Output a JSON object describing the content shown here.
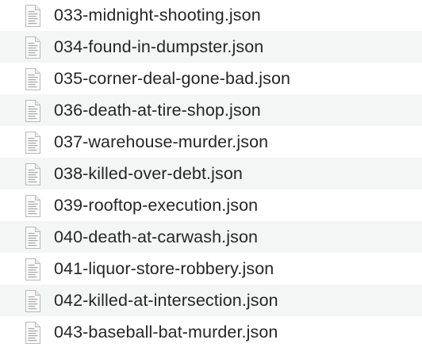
{
  "file_list": {
    "icon": "json-document-icon",
    "colors": {
      "row_alt": "#f4f5f5",
      "text": "#262626"
    },
    "items": [
      {
        "name": "033-midnight-shooting.json"
      },
      {
        "name": "034-found-in-dumpster.json"
      },
      {
        "name": "035-corner-deal-gone-bad.json"
      },
      {
        "name": "036-death-at-tire-shop.json"
      },
      {
        "name": "037-warehouse-murder.json"
      },
      {
        "name": "038-killed-over-debt.json"
      },
      {
        "name": "039-rooftop-execution.json"
      },
      {
        "name": "040-death-at-carwash.json"
      },
      {
        "name": "041-liquor-store-robbery.json"
      },
      {
        "name": "042-killed-at-intersection.json"
      },
      {
        "name": "043-baseball-bat-murder.json"
      }
    ]
  }
}
